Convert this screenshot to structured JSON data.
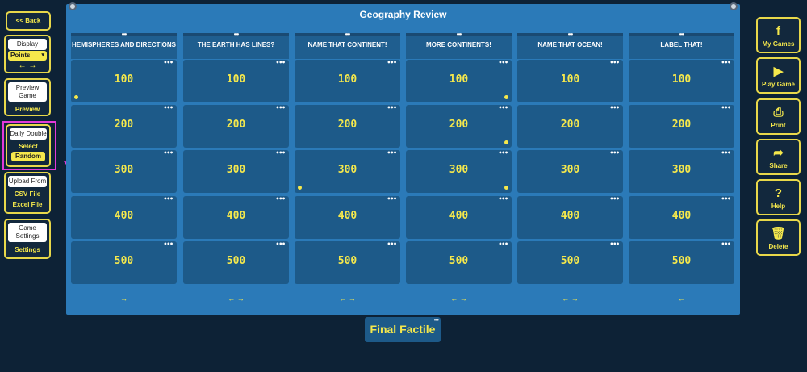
{
  "left_toolbar": {
    "back": "<< Back",
    "display": {
      "title": "Display",
      "select_value": "Points",
      "arrows": "← →"
    },
    "preview": {
      "title": "Preview Game",
      "link": "Preview"
    },
    "daily_double": {
      "title": "Daily Double",
      "select": "Select",
      "random": "Random"
    },
    "upload": {
      "title": "Upload From",
      "csv": "CSV File",
      "excel": "Excel File"
    },
    "settings": {
      "title": "Game Settings",
      "link": "Settings"
    }
  },
  "board": {
    "title": "Geography Review",
    "categories": [
      "HEMISPHERES AND DIRECTIONS",
      "THE EARTH HAS LINES?",
      "NAME THAT CONTINENT!",
      "MORE CONTINENTS!",
      "NAME THAT OCEAN!",
      "LABEL THAT!"
    ],
    "values": [
      "100",
      "200",
      "300",
      "400",
      "500"
    ],
    "column_arrows": [
      "→",
      "← →",
      "← →",
      "← →",
      "← →",
      "←"
    ],
    "more_icon": "•••",
    "daily_double_markers": [
      [
        0,
        0
      ],
      [
        3,
        0
      ],
      [
        3,
        1
      ],
      [
        2,
        2
      ],
      [
        3,
        2
      ]
    ]
  },
  "final": "Final Factile",
  "right_toolbar": [
    {
      "icon": "facebook-icon",
      "glyph": "f",
      "label": "My Games"
    },
    {
      "icon": "play-icon",
      "glyph": "▶",
      "label": "Play Game"
    },
    {
      "icon": "print-icon",
      "glyph": "⎙",
      "label": "Print"
    },
    {
      "icon": "share-icon",
      "glyph": "➦",
      "label": "Share"
    },
    {
      "icon": "help-icon",
      "glyph": "?",
      "label": "Help"
    },
    {
      "icon": "trash-icon",
      "glyph": "🗑",
      "label": "Delete"
    }
  ],
  "colors": {
    "accent": "#f5e84c",
    "board": "#2b7ab8",
    "cell": "#1d5a89",
    "background": "#0d2236",
    "highlight": "#e23ad8"
  }
}
